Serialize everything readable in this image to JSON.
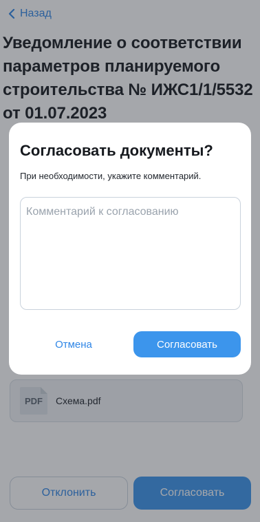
{
  "nav": {
    "back_label": "Назад"
  },
  "page": {
    "title": "Уведомление о соответствии параметров планируемого строительства № ИЖС1/1/5532 от 01.07.2023"
  },
  "attachment": {
    "type_label": "PDF",
    "name": "Схема.pdf"
  },
  "actions": {
    "decline_label": "Отклонить",
    "approve_label": "Согласовать"
  },
  "dialog": {
    "title": "Согласовать документы?",
    "subtitle": "При необходимости, укажите комментарий.",
    "comment": {
      "value": "",
      "placeholder": "Комментарий к согласованию"
    },
    "cancel_label": "Отмена",
    "confirm_label": "Согласовать"
  },
  "colors": {
    "accent": "#2f86e6",
    "primary_button": "#3c95ec",
    "overlay": "rgba(40,46,56,0.42)"
  }
}
